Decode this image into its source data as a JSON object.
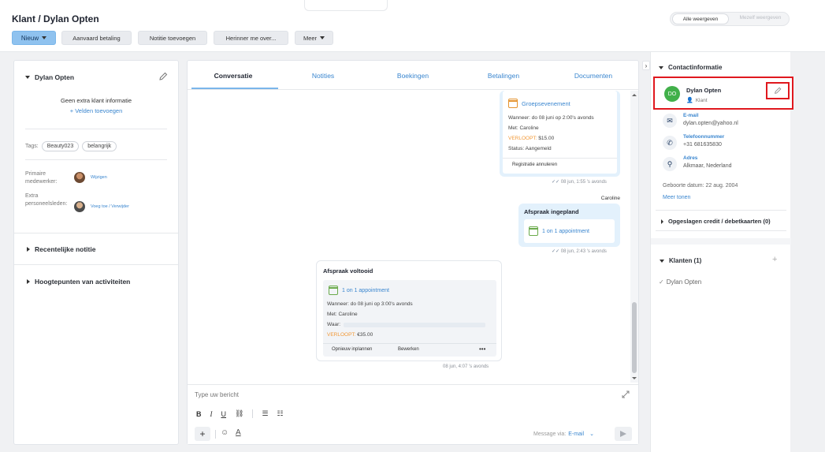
{
  "header": {
    "title": "Klant / Dylan Opten",
    "view_all": "Alle weergeven",
    "view_self": "Mezelf weergeven"
  },
  "toolbar": {
    "new": "Nieuw",
    "accept_payment": "Aanvaard betaling",
    "add_note": "Notitie toevoegen",
    "remind": "Herinner me over...",
    "more": "Meer"
  },
  "left": {
    "name": "Dylan Opten",
    "no_info": "Geen extra klant informatie",
    "add_fields": "+ Velden toevoegen",
    "tags_label": "Tags:",
    "tags": [
      "Beauty023",
      "belangrijk"
    ],
    "primary_label": "Primaire medewerker:",
    "primary_action": "Wijzigen",
    "extra_label": "Extra personeelsleden:",
    "extra_action": "Voeg toe / Verwijder",
    "recent_note": "Recentelijke notitie",
    "highlights": "Hoogtepunten van activiteiten"
  },
  "tabs": [
    "Conversatie",
    "Notities",
    "Boekingen",
    "Betalingen",
    "Documenten"
  ],
  "messages": {
    "group": {
      "title": "Groepsevenement",
      "when": "Wanneer: do 08 juni op 2:00's avonds",
      "with": "Met: Caroline",
      "expires_label": "VERLOOPT:",
      "expires_value": "$15.00",
      "status": "Status: Aangemeld",
      "action": "Registratie annuleren",
      "time": "08 jun, 1:55 's avonds"
    },
    "sender": "Caroline",
    "scheduled": {
      "title": "Afspraak ingepland",
      "appt": "1 on 1 appointment",
      "time": "08 jun, 2:43 's avonds"
    },
    "completed": {
      "title": "Afspraak voltooid",
      "appt": "1 on 1 appointment",
      "when": "Wanneer:  do 08 juni op 3:00's avonds",
      "with": "Met: Caroline",
      "where": "Waar:",
      "expires_label": "VERLOOPT:",
      "expires_value": "€35.00",
      "reschedule": "Opnieuw inplannen",
      "edit": "Bewerken",
      "more": "•••",
      "time": "08 jun, 4:07 's avonds"
    }
  },
  "composer": {
    "placeholder": "Type uw bericht",
    "via_label": "Message via:",
    "via_value": "E-mail"
  },
  "right": {
    "section": "Contactinformatie",
    "avatar_initials": "DO",
    "name": "Dylan Opten",
    "role": "Klant",
    "email_label": "E-mail",
    "email": "dylan.opten@yahoo.nl",
    "phone_label": "Telefoonnummer",
    "phone": "+31 681635830",
    "address_label": "Adres",
    "address": "Alkmaar, Nederland",
    "birth": "Geboorte datum: 22 aug. 2004",
    "more": "Meer tonen",
    "cards": "Opgeslagen credit / debetkaarten (0)",
    "clients": "Klanten (1)",
    "client_item": "Dylan Opten"
  },
  "colors": {
    "accent": "#3a86cf",
    "primary_button": "#8fc2ef",
    "highlight": "#e0181e",
    "avatar_green": "#41b04a"
  }
}
